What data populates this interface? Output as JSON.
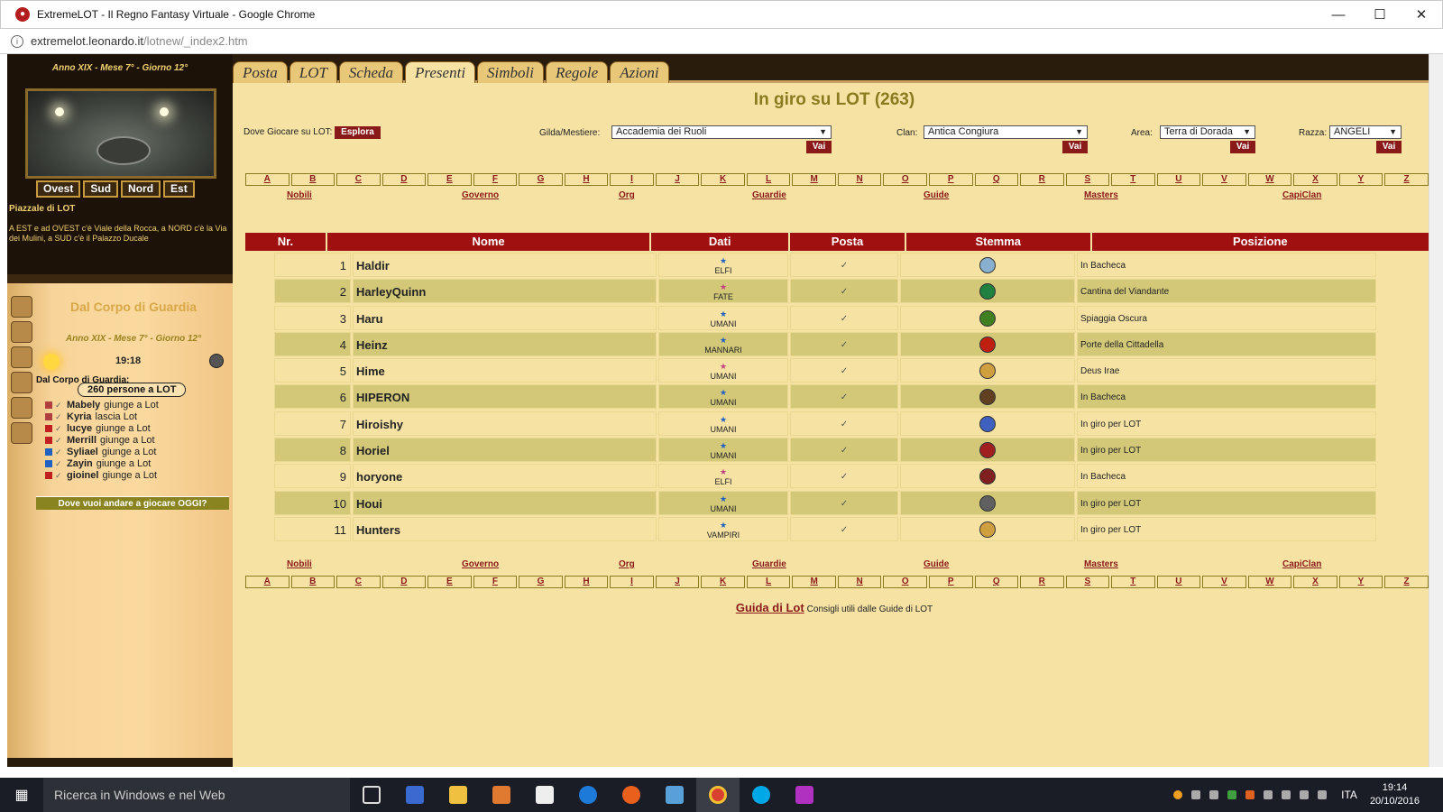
{
  "window": {
    "title": "ExtremeLOT - Il Regno Fantasy Virtuale - Google Chrome",
    "url_host": "extremelot.leonardo.it",
    "url_path": "/lotnew/_index2.htm"
  },
  "left": {
    "date": "Anno XIX - Mese 7° - Giorno 12°",
    "dirs": [
      "Ovest",
      "Sud",
      "Nord",
      "Est"
    ],
    "place": "Piazzale di LOT",
    "description": "A EST e ad OVEST c'è Viale della Rocca, a NORD c'è la Via dei Mulini, a SUD c'è il Palazzo Ducale",
    "guard_title": "Dal Corpo di Guardia",
    "guard_date": "Anno XIX - Mese 7° - Giorno 12°",
    "time": "19:18",
    "dal_corpo": "Dal Corpo di Guardia:",
    "people": "260 persone a LOT",
    "events": [
      {
        "name": "Mabely",
        "action": "giunge a Lot",
        "color": "#b04040"
      },
      {
        "name": "Kyria",
        "action": "lascia Lot",
        "color": "#b04040"
      },
      {
        "name": "lucye",
        "action": "giunge a Lot",
        "color": "#c02020"
      },
      {
        "name": "Merrill",
        "action": "giunge a Lot",
        "color": "#c02020"
      },
      {
        "name": "Syliael",
        "action": "giunge a Lot",
        "color": "#2060c0"
      },
      {
        "name": "Zayin",
        "action": "giunge a Lot",
        "color": "#2060c0"
      },
      {
        "name": "gioinel",
        "action": "giunge a Lot",
        "color": "#c02020"
      }
    ],
    "dove_btn": "Dove vuoi andare a giocare OGGI?"
  },
  "content": {
    "tabs": [
      "Posta",
      "LOT",
      "Scheda",
      "Presenti",
      "Simboli",
      "Regole",
      "Azioni"
    ],
    "active_tab": "Presenti",
    "title": "In giro su LOT (263)",
    "dove_label": "Dove Giocare su LOT:",
    "esplora": "Esplora",
    "gilda_label": "Gilda/Mestiere:",
    "gilda_value": "Accademia dei Ruoli",
    "clan_label": "Clan:",
    "clan_value": "Antica Congiura",
    "area_label": "Area:",
    "area_value": "Terra di Dorada",
    "razza_label": "Razza:",
    "razza_value": "ANGELI",
    "vai": "Vai",
    "letters": [
      "A",
      "B",
      "C",
      "D",
      "E",
      "F",
      "G",
      "H",
      "I",
      "J",
      "K",
      "L",
      "M",
      "N",
      "O",
      "P",
      "Q",
      "R",
      "S",
      "T",
      "U",
      "V",
      "W",
      "X",
      "Y",
      "Z"
    ],
    "categories": [
      "Nobili",
      "Governo",
      "Org",
      "Guardie",
      "Guide",
      "Masters",
      "CapiClan"
    ],
    "headers": [
      "Nr.",
      "Nome",
      "Dati",
      "Posta",
      "Stemma",
      "Posizione"
    ],
    "rows": [
      {
        "nr": "1",
        "name": "Haldir",
        "race": "ELFI",
        "race_color": "#2060c0",
        "emblem": "#8ab0d0",
        "pos": "In Bacheca"
      },
      {
        "nr": "2",
        "name": "HarleyQuinn",
        "race": "FATE",
        "race_color": "#c04080",
        "emblem": "#208040",
        "pos": "Cantina del Viandante"
      },
      {
        "nr": "3",
        "name": "Haru",
        "race": "UMANI",
        "race_color": "#2060c0",
        "emblem": "#408020",
        "pos": "Spiaggia Oscura"
      },
      {
        "nr": "4",
        "name": "Heinz",
        "race": "MANNARI",
        "race_color": "#2060c0",
        "emblem": "#c02010",
        "pos": "Porte della Cittadella"
      },
      {
        "nr": "5",
        "name": "Hime",
        "race": "UMANI",
        "race_color": "#c04080",
        "emblem": "#d0a040",
        "pos": "Deus Irae"
      },
      {
        "nr": "6",
        "name": "HIPERON",
        "race": "UMANI",
        "race_color": "#2060c0",
        "emblem": "#604020",
        "pos": "In Bacheca"
      },
      {
        "nr": "7",
        "name": "Hiroishy",
        "race": "UMANI",
        "race_color": "#2060c0",
        "emblem": "#4060c0",
        "pos": "In giro per LOT"
      },
      {
        "nr": "8",
        "name": "Horiel",
        "race": "UMANI",
        "race_color": "#2060c0",
        "emblem": "#a02020",
        "pos": "In giro per LOT"
      },
      {
        "nr": "9",
        "name": "horyone",
        "race": "ELFI",
        "race_color": "#c04080",
        "emblem": "#802020",
        "pos": "In Bacheca"
      },
      {
        "nr": "10",
        "name": "Houi",
        "race": "UMANI",
        "race_color": "#2060c0",
        "emblem": "#606060",
        "pos": "In giro per LOT"
      },
      {
        "nr": "11",
        "name": "Hunters",
        "race": "VAMPIRI",
        "race_color": "#2060c0",
        "emblem": "#d0a040",
        "pos": "In giro per LOT"
      }
    ],
    "guida_link": "Guida di Lot",
    "guida_text": "Consigli utili dalle Guide di LOT"
  },
  "taskbar": {
    "search": "Ricerca in Windows e nel Web",
    "lang": "ITA",
    "time": "19:14",
    "date": "20/10/2016"
  }
}
